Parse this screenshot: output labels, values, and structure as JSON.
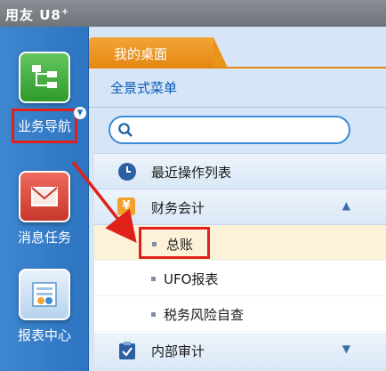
{
  "app": {
    "title_main": "用友 U8",
    "title_sup": "+"
  },
  "rail": {
    "items": [
      {
        "label": "业务导航",
        "icon": "org-chart-icon"
      },
      {
        "label": "消息任务",
        "icon": "mail-icon"
      },
      {
        "label": "报表中心",
        "icon": "report-icon"
      }
    ]
  },
  "main": {
    "tab_label": "我的桌面",
    "menu_title": "全景式菜单",
    "search_placeholder": "",
    "sections": [
      {
        "label": "最近操作列表",
        "icon": "clock-icon"
      },
      {
        "label": "财务会计",
        "icon": "yen-icon",
        "icon_text": "¥",
        "expanded": true,
        "items": [
          {
            "label": "总账"
          },
          {
            "label": "UFO报表"
          },
          {
            "label": "税务风险自查"
          }
        ]
      },
      {
        "label": "内部审计",
        "icon": "clipboard-check-icon"
      }
    ]
  },
  "colors": {
    "accent_orange": "#e48812",
    "rail_blue": "#2d74c1",
    "highlight_red": "#e0211b"
  }
}
